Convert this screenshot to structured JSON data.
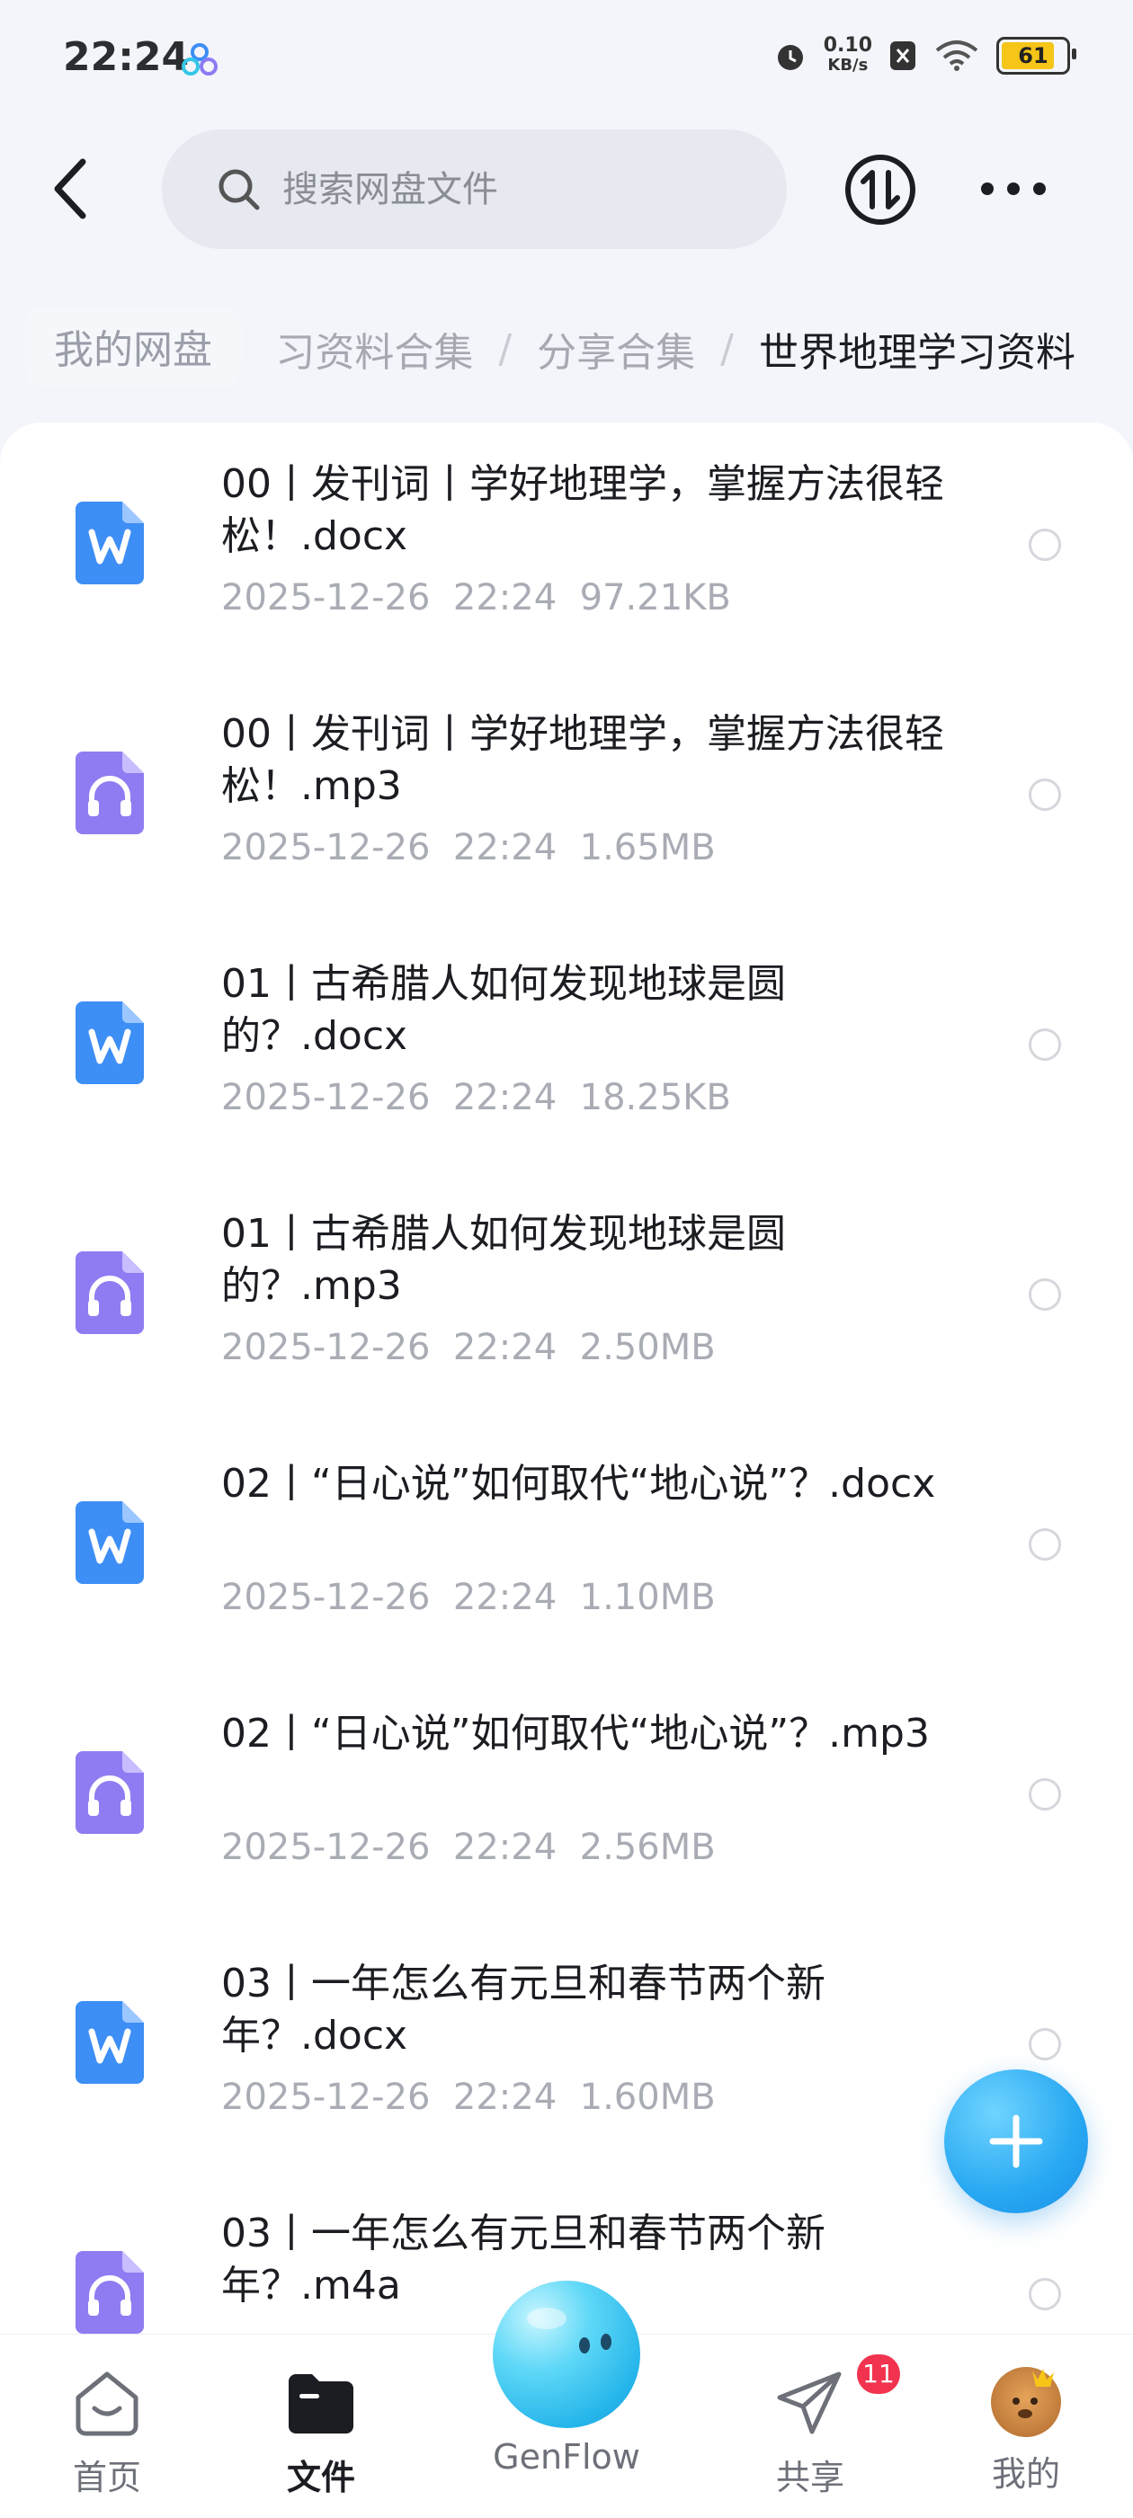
{
  "status_bar": {
    "time": "22:24",
    "net_speed": "0.10",
    "net_unit": "KB/s",
    "battery": "61",
    "icons": [
      "app-logo-icon",
      "alarm-icon",
      "notification-x-icon",
      "wifi-icon",
      "battery-icon"
    ]
  },
  "top_nav": {
    "search_placeholder": "搜索网盘文件",
    "icons": [
      "back-icon",
      "search-icon",
      "transfer-icon",
      "more-icon"
    ]
  },
  "breadcrumb": {
    "home": "我的网盘",
    "items": [
      "习资料合集",
      "分享合集"
    ],
    "current": "世界地理学习资料",
    "separator": "/"
  },
  "files": [
    {
      "type": "word",
      "name": "00丨发刊词丨学好地理学，掌握方法很轻松！.docx",
      "date": "2025-12-26",
      "time": "22:24",
      "size": "97.21KB"
    },
    {
      "type": "audio",
      "name": "00丨发刊词丨学好地理学，掌握方法很轻松！.mp3",
      "date": "2025-12-26",
      "time": "22:24",
      "size": "1.65MB"
    },
    {
      "type": "word",
      "name": "01丨古希腊人如何发现地球是圆的？.docx",
      "date": "2025-12-26",
      "time": "22:24",
      "size": "18.25KB"
    },
    {
      "type": "audio",
      "name": "01丨古希腊人如何发现地球是圆的？.mp3",
      "date": "2025-12-26",
      "time": "22:24",
      "size": "2.50MB"
    },
    {
      "type": "word",
      "name": "02丨“日心说”如何取代“地心说”？.docx",
      "date": "2025-12-26",
      "time": "22:24",
      "size": "1.10MB"
    },
    {
      "type": "audio",
      "name": "02丨“日心说”如何取代“地心说”？.mp3",
      "date": "2025-12-26",
      "time": "22:24",
      "size": "2.56MB"
    },
    {
      "type": "word",
      "name": "03丨一年怎么有元旦和春节两个新年？.docx",
      "date": "2025-12-26",
      "time": "22:24",
      "size": "1.60MB"
    },
    {
      "type": "audio",
      "name": "03丨一年怎么有元旦和春节两个新年？.m4a",
      "date": "",
      "time": "",
      "size": ""
    }
  ],
  "fab": {
    "icon": "plus-icon"
  },
  "tab_bar": {
    "home": "首页",
    "files": "文件",
    "genflow": "GenFlow",
    "share": "共享",
    "share_badge": "11",
    "me": "我的"
  },
  "colors": {
    "accent": "#2aa7f0",
    "word_icon": "#3d8ef5",
    "audio_icon": "#8f7cf2",
    "badge": "#f2334f",
    "battery": "#f5c518"
  }
}
